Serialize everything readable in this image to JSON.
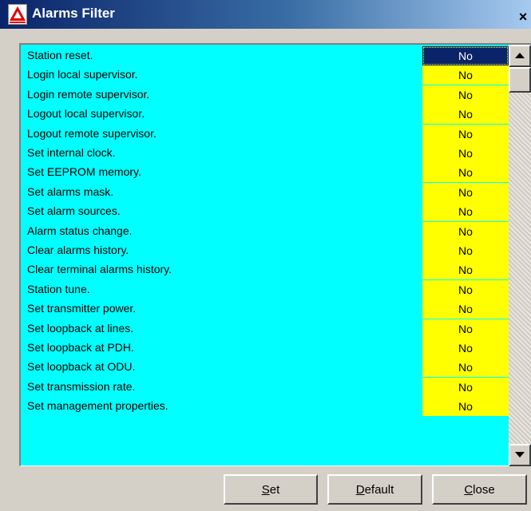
{
  "window": {
    "title": "Alarms Filter",
    "close_glyph": "×",
    "icon": "warning-triangle-icon"
  },
  "list": {
    "rows": [
      {
        "label": "Station reset.",
        "value": "No",
        "selected": true
      },
      {
        "label": "Login local supervisor.",
        "value": "No"
      },
      {
        "label": "Login remote supervisor.",
        "value": "No"
      },
      {
        "label": "Logout local supervisor.",
        "value": "No"
      },
      {
        "label": "Logout remote supervisor.",
        "value": "No"
      },
      {
        "label": "Set internal clock.",
        "value": "No"
      },
      {
        "label": "Set EEPROM memory.",
        "value": "No"
      },
      {
        "label": "Set alarms mask.",
        "value": "No"
      },
      {
        "label": "Set alarm sources.",
        "value": "No"
      },
      {
        "label": "Alarm status change.",
        "value": "No"
      },
      {
        "label": "Clear alarms history.",
        "value": "No"
      },
      {
        "label": "Clear terminal alarms history.",
        "value": "No"
      },
      {
        "label": "Station tune.",
        "value": "No"
      },
      {
        "label": "Set transmitter power.",
        "value": "No"
      },
      {
        "label": "Set loopback at lines.",
        "value": "No"
      },
      {
        "label": "Set loopback at PDH.",
        "value": "No"
      },
      {
        "label": "Set loopback at ODU.",
        "value": "No"
      },
      {
        "label": "Set transmission rate.",
        "value": "No"
      },
      {
        "label": "Set management properties.",
        "value": "No"
      }
    ]
  },
  "buttons": {
    "set": {
      "accel": "S",
      "rest": "et"
    },
    "default": {
      "accel": "D",
      "rest": "efault"
    },
    "close": {
      "accel": "C",
      "rest": "lose"
    }
  },
  "colors": {
    "list_background": "#00ffff",
    "value_background": "#ffff00",
    "selected_background": "#0a246a"
  }
}
